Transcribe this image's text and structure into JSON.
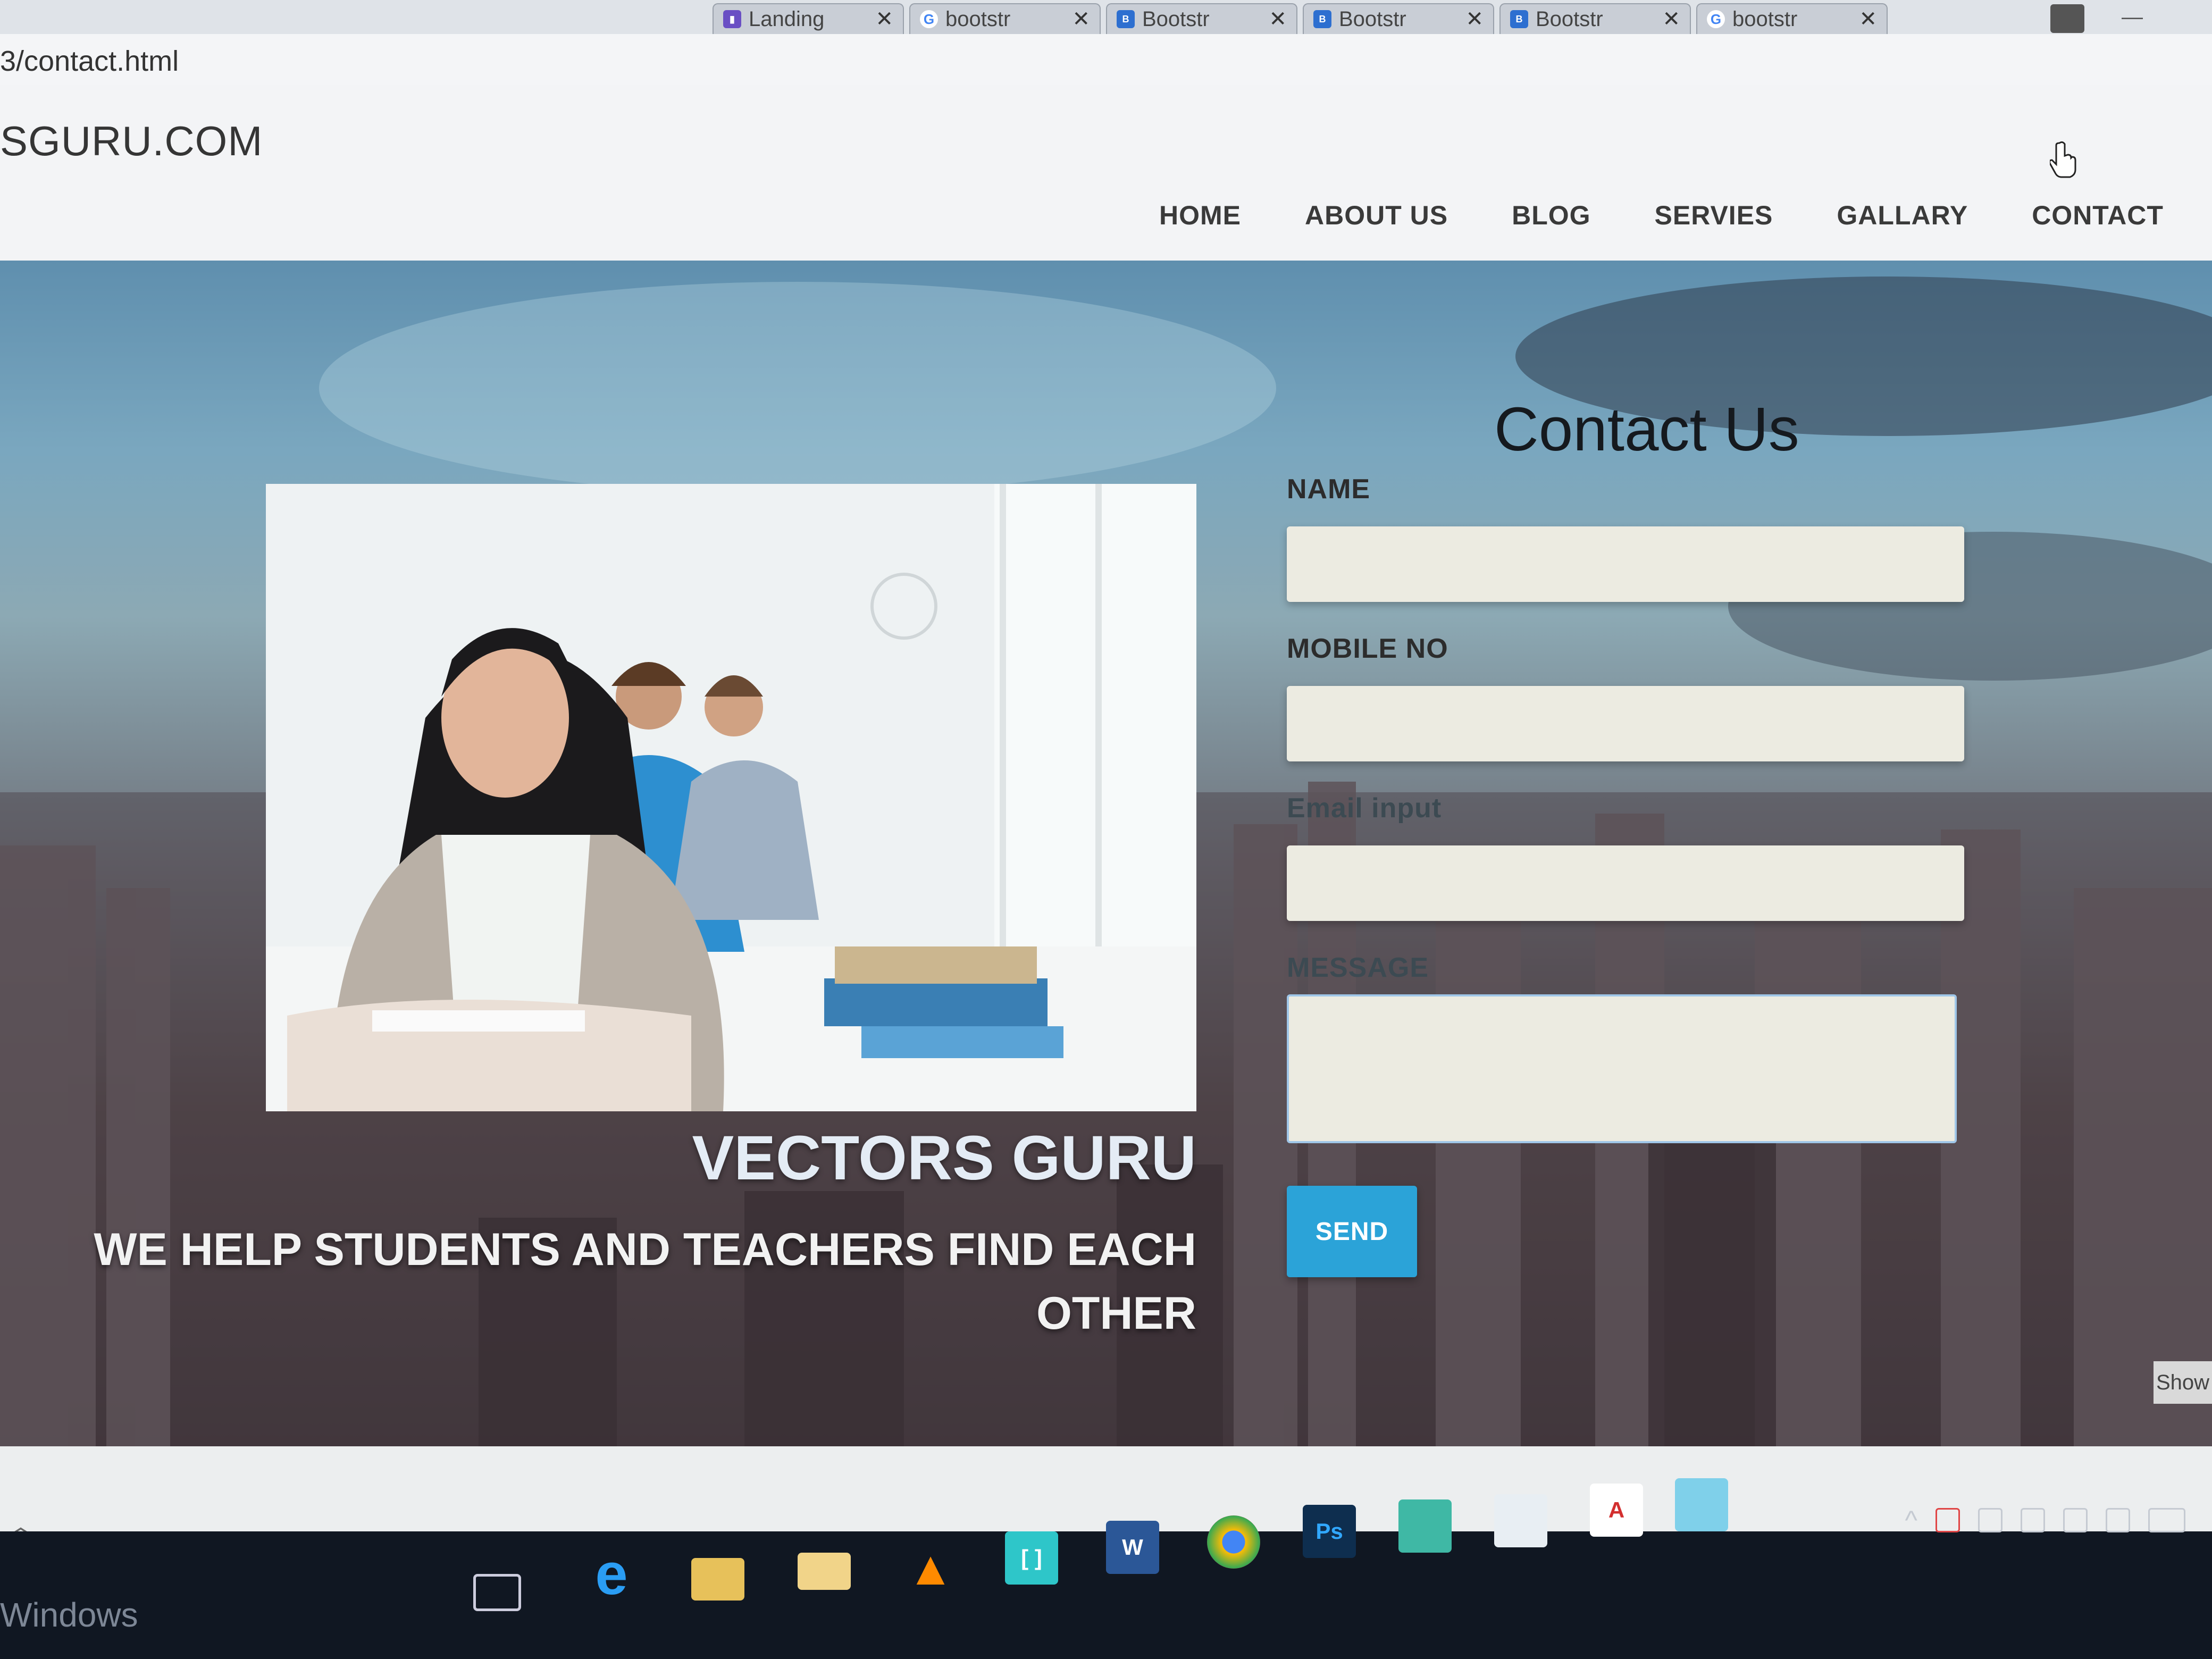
{
  "browser": {
    "tabs": [
      {
        "title": "Landing",
        "favicon": "generic-page-icon"
      },
      {
        "title": "bootstr",
        "favicon": "google-icon"
      },
      {
        "title": "Bootstr",
        "favicon": "bootstrap-icon"
      },
      {
        "title": "Bootstr",
        "favicon": "bootstrap-icon"
      },
      {
        "title": "Bootstr",
        "favicon": "bootstrap-icon"
      },
      {
        "title": "bootstr",
        "favicon": "google-icon"
      }
    ],
    "url": "3/contact.html"
  },
  "site": {
    "brand": "SGURU.COM",
    "nav": [
      "HOME",
      "ABOUT US",
      "BLOG",
      "SERVIES",
      "GALLARY",
      "CONTACT"
    ]
  },
  "hero": {
    "title": "VECTORS GURU",
    "subtitle": "WE HELP STUDENTS AND TEACHERS FIND EACH OTHER"
  },
  "contact": {
    "title": "Contact Us",
    "name_label": "NAME",
    "mobile_label": "MOBILE NO",
    "email_label": "Email input",
    "message_label": "MESSAGE",
    "send_label": "SEND"
  },
  "side_button": "Show",
  "taskbar": {
    "label": "Windows",
    "apps": [
      "task-view-icon",
      "edge-icon",
      "file-explorer-icon",
      "folder-icon",
      "vlc-icon",
      "brackets-icon",
      "word-icon",
      "chrome-icon",
      "photoshop-icon",
      "app-icon",
      "photos-icon",
      "acrobat-icon",
      "notes-icon"
    ]
  },
  "colors": {
    "accent": "#2ba3d8",
    "header_bg": "#f3f4f6",
    "taskbar_bg": "#101722"
  }
}
